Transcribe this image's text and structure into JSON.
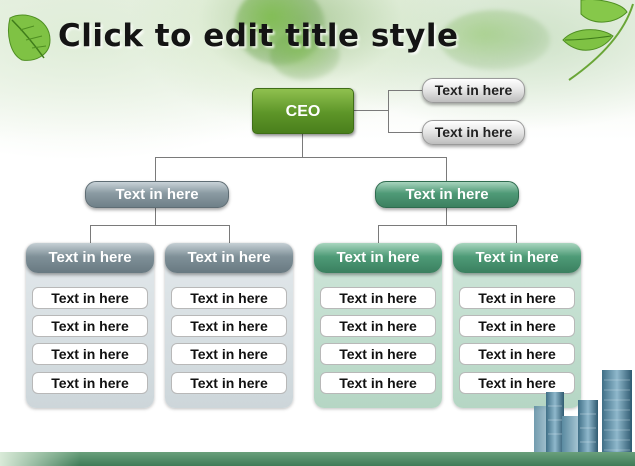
{
  "slide": {
    "title": "Click to edit title style"
  },
  "org_chart": {
    "ceo": "CEO",
    "ceo_side_boxes": [
      "Text in here",
      "Text in here"
    ],
    "divisions": [
      {
        "label": "Text in here",
        "style": "gray",
        "columns": [
          {
            "header": "Text in here",
            "items": [
              "Text in here",
              "Text in here",
              "Text in here",
              "Text in here"
            ]
          },
          {
            "header": "Text in here",
            "items": [
              "Text in here",
              "Text in here",
              "Text in here",
              "Text in here"
            ]
          }
        ]
      },
      {
        "label": "Text in here",
        "style": "teal",
        "columns": [
          {
            "header": "Text in here",
            "items": [
              "Text in here",
              "Text in here",
              "Text in here",
              "Text in here"
            ]
          },
          {
            "header": "Text in here",
            "items": [
              "Text in here",
              "Text in here",
              "Text in here",
              "Text in here"
            ]
          }
        ]
      }
    ]
  },
  "colors": {
    "ceo": "#5d9528",
    "gray_division": "#7f9098",
    "teal_division": "#4e9b77",
    "footer": "#3f7b57"
  }
}
